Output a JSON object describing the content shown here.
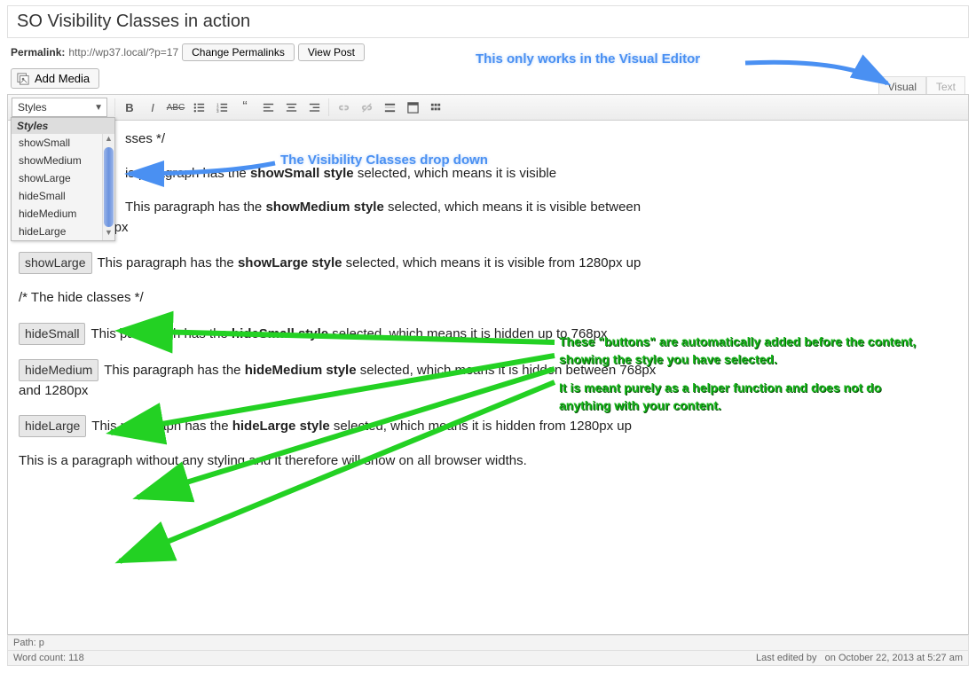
{
  "title": "SO Visibility Classes in action",
  "permalink": {
    "label": "Permalink:",
    "url": "http://wp37.local/?p=17",
    "change_btn": "Change Permalinks",
    "view_btn": "View Post"
  },
  "add_media": "Add Media",
  "tabs": {
    "visual": "Visual",
    "text": "Text"
  },
  "toolbar": {
    "styles_label": "Styles"
  },
  "dropdown": {
    "header": "Styles",
    "items": [
      "showSmall",
      "showMedium",
      "showLarge",
      "hideSmall",
      "hideMedium",
      "hideLarge"
    ]
  },
  "content": {
    "show_header_tail": "sses */",
    "p1_badge_hidden": "showSmall",
    "p1_a": "is paragraph has the ",
    "p1_b": "showSmall style",
    "p1_c": " selected, which means it is visible",
    "p2_a": "This paragraph has the ",
    "p2_b": "showMedium style",
    "p2_c": " selected, which means it is visible between 768px and 1280px",
    "p3_badge": "showLarge",
    "p3_a": "This paragraph has the ",
    "p3_b": "showLarge style",
    "p3_c": " selected, which means it is visible from 1280px up",
    "hide_header": "/* The hide classes */",
    "p4_badge": "hideSmall",
    "p4_a": "This paragraph has the ",
    "p4_b": "hideSmall style",
    "p4_c": " selected, which means it is hidden up to 768px",
    "p5_badge": "hideMedium",
    "p5_a": "This paragraph has the ",
    "p5_b": "hideMedium style",
    "p5_c": " selected, which means it is hidden between 768px and 1280px",
    "p6_badge": "hideLarge",
    "p6_a": "This paragraph has the ",
    "p6_b": "hideLarge style",
    "p6_c": " selected, which means it is hidden from 1280px up",
    "p7": "This is a paragraph without any styling and it therefore will show on all browser widths."
  },
  "status": {
    "path_label": "Path: ",
    "path_value": "p",
    "word_count": "Word count: 118",
    "last_edited_label": "Last edited by",
    "last_edited_value": "on October 22, 2013 at 5:27 am"
  },
  "annotations": {
    "top": "This only works in the Visual Editor",
    "dd": "The Visibility Classes drop down",
    "green1": "These \"buttons\" are automatically added before the content, showing the style you have selected.",
    "green2": "It is meant purely as a helper function and does not do anything with your content."
  }
}
